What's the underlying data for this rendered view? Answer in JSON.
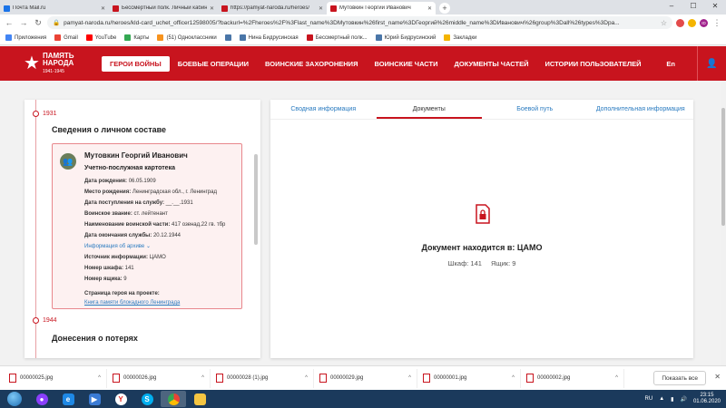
{
  "browser": {
    "tabs": [
      {
        "title": "Почта Mail.ru",
        "color": "#1a73e8",
        "active": false
      },
      {
        "title": "Бессмертный полк. Личный кабинет",
        "color": "#c8141e",
        "active": false
      },
      {
        "title": "https://pamyat-naroda.ru/heroes/",
        "color": "#c8141e",
        "active": false
      },
      {
        "title": "Мутовкин Георгий Иванович",
        "color": "#c8141e",
        "active": true
      }
    ],
    "new_tab": "+",
    "window_controls": [
      "–",
      "☐",
      "✕"
    ],
    "url": "pamyat-naroda.ru/heroes/kld-card_uchet_officer12598005/?backurl=%2Fheroes%2F%3Flast_name%3DМутовкин%26first_name%3DГеоргий%26middle_name%3DИванович%26group%3Dall%26types%3Dpa...",
    "ext_labels": [
      "ID"
    ]
  },
  "bookmarks": [
    {
      "label": "Приложения",
      "color": "#4285f4"
    },
    {
      "label": "Gmail",
      "color": "#ea4335"
    },
    {
      "label": "YouTube",
      "color": "#ff0000"
    },
    {
      "label": "Карты",
      "color": "#34a853"
    },
    {
      "label": "(51) Одноклассники",
      "color": "#f7931e"
    },
    {
      "label": "",
      "color": "#4a76a8"
    },
    {
      "label": "Нина Бидрусинская",
      "color": "#4a76a8"
    },
    {
      "label": "Бессмертный полк...",
      "color": "#c8141e"
    },
    {
      "label": "Юрий Бидрусинский",
      "color": "#4a76a8"
    },
    {
      "label": "Закладки",
      "color": "#f4b400"
    }
  ],
  "site": {
    "logo_line1": "ПАМЯТЬ",
    "logo_line2": "НАРОДА",
    "logo_years": "1941-1945",
    "nav": [
      {
        "label": "ГЕРОИ ВОЙНЫ",
        "active": true
      },
      {
        "label": "БОЕВЫЕ ОПЕРАЦИИ",
        "active": false
      },
      {
        "label": "ВОИНСКИЕ ЗАХОРОНЕНИЯ",
        "active": false
      },
      {
        "label": "ВОИНСКИЕ ЧАСТИ",
        "active": false
      },
      {
        "label": "ДОКУМЕНТЫ ЧАСТЕЙ",
        "active": false
      },
      {
        "label": "ИСТОРИИ ПОЛЬЗОВАТЕЛЕЙ",
        "active": false
      }
    ],
    "lang": "En",
    "accent": "#c8141e"
  },
  "left": {
    "year1": "1931",
    "section1_title": "Сведения о личном составе",
    "card": {
      "name": "Мутовкин Георгий Иванович",
      "type": "Учетно-послужная картотека",
      "fields": [
        {
          "label": "Дата рождения:",
          "value": "06.05.1909"
        },
        {
          "label": "Место рождения:",
          "value": "Ленинградская обл., г. Ленинград"
        },
        {
          "label": "Дата поступления на службу:",
          "value": "__.__.1931"
        },
        {
          "label": "Воинское звание:",
          "value": "ст. лейтенант"
        },
        {
          "label": "Наименование воинской части:",
          "value": "417 озенад,22 гв. тбр"
        },
        {
          "label": "Дата окончания службы:",
          "value": "20.12.1944"
        }
      ],
      "archive_link": "Информация об архиве",
      "fields2": [
        {
          "label": "Источник информации:",
          "value": "ЦАМО"
        },
        {
          "label": "Номер шкафа:",
          "value": "141"
        },
        {
          "label": "Номер ящика:",
          "value": "9"
        }
      ],
      "hero_page_label": "Страница героя на проекте:",
      "hero_page_link": "Книга памяти блокадного Ленинграда"
    },
    "year2": "1944",
    "section2_title": "Донесения о потерях"
  },
  "right": {
    "tabs": [
      {
        "label": "Сводная информация",
        "active": false
      },
      {
        "label": "Документы",
        "active": true
      },
      {
        "label": "Боевой путь",
        "active": false
      },
      {
        "label": "Дополнительная информация",
        "active": false
      }
    ],
    "doc_location": "Документ находится в: ЦАМО",
    "cabinet": "Шкаф: 141",
    "box": "Ящик: 9"
  },
  "downloads": {
    "files": [
      "00000025.jpg",
      "00000026.jpg",
      "00000028 (1).jpg",
      "00000029.jpg",
      "00000001.jpg",
      "00000002.jpg"
    ],
    "show_all": "Показать все",
    "close": "✕"
  },
  "taskbar": {
    "lang": "RU",
    "time": "23:15",
    "date": "01.06.2020"
  }
}
